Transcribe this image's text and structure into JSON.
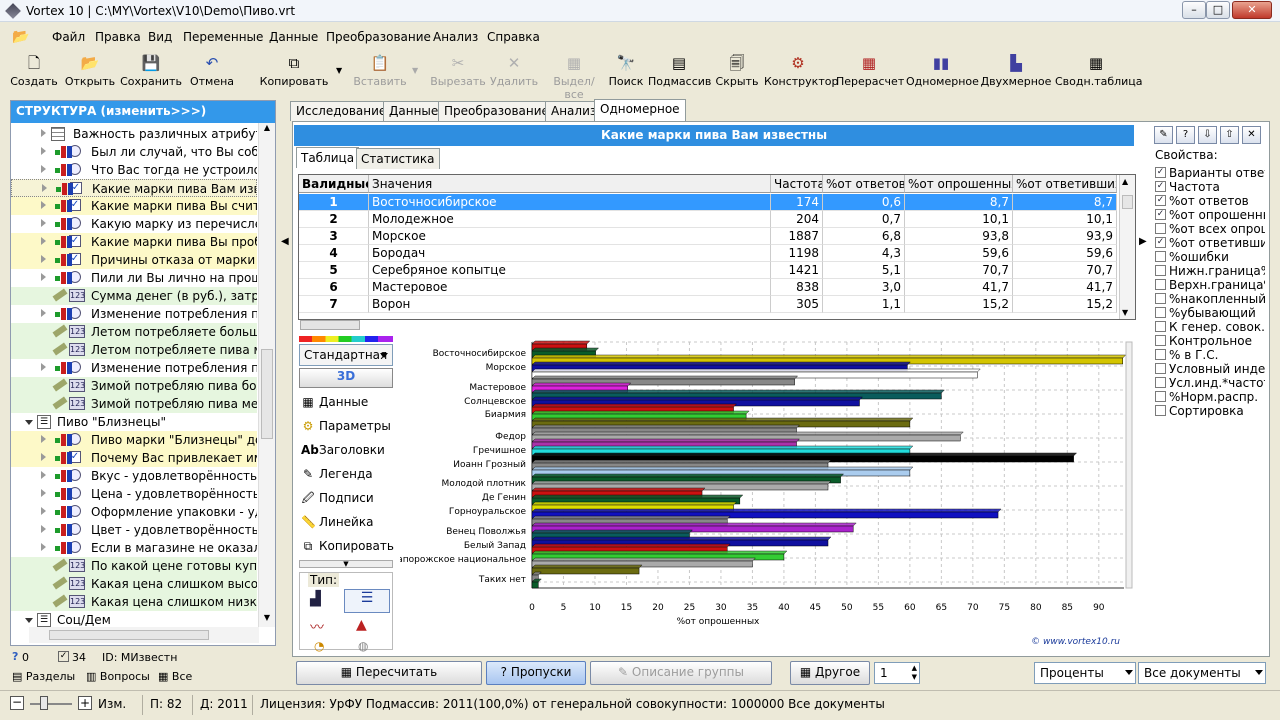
{
  "window": {
    "title": "Vortex 10 | C:\\MY\\Vortex\\V10\\Demo\\Пиво.vrt"
  },
  "menu": [
    "Файл",
    "Правка",
    "Вид",
    "Переменные",
    "Данные",
    "Преобразование",
    "Анализ",
    "Справка"
  ],
  "toolbar": {
    "create": "Создать",
    "open": "Открыть",
    "save": "Сохранить",
    "undo": "Отмена",
    "copy": "Копировать",
    "paste": "Вставить",
    "cut": "Вырезать",
    "delete": "Удалить",
    "select_all": "Выдел/все",
    "search": "Поиск",
    "subarray": "Подмассив",
    "hide": "Скрыть",
    "constructor": "Конструктор",
    "recalc": "Перерасчет",
    "onedim": "Одномерное",
    "twodim": "Двухмерное",
    "pivot": "Сводн.таблица"
  },
  "structure": {
    "header": "СТРУКТУРА (изменить>>>)",
    "items": [
      {
        "label": "Важность различных атрибутов",
        "icon": "grid"
      },
      {
        "label": "Был ли случай, что Вы собир",
        "icon": "q"
      },
      {
        "label": "Что Вас тогда не устроило",
        "icon": "q"
      },
      {
        "label": "Какие марки пива Вам извест",
        "icon": "qc"
      },
      {
        "label": "Какие марки пива Вы считает",
        "icon": "qc"
      },
      {
        "label": "Какую марку из перечисленн",
        "icon": "q"
      },
      {
        "label": "Какие марки пива Вы пробов",
        "icon": "qc"
      },
      {
        "label": "Причины отказа от марки пи",
        "icon": "qc"
      },
      {
        "label": "Пили ли Вы лично на прошло",
        "icon": "q"
      },
      {
        "label": "Сумма денег (в руб.), затрач",
        "icon": "n"
      },
      {
        "label": "Изменение потребления пив",
        "icon": "q"
      },
      {
        "label": "Летом потребляете больше",
        "icon": "n"
      },
      {
        "label": "Летом потребляете пива ме",
        "icon": "n"
      },
      {
        "label": "Изменение потребления пив",
        "icon": "q"
      },
      {
        "label": "Зимой потребляю пива боль",
        "icon": "n"
      },
      {
        "label": "Зимой потребляю пива мень",
        "icon": "n"
      },
      {
        "label": "Пиво \"Близнецы\"",
        "icon": "folder"
      },
      {
        "label": "Пиво марки \"Близнецы\" дорс",
        "icon": "q"
      },
      {
        "label": "Почему Вас привлекает имен",
        "icon": "qc"
      },
      {
        "label": "Вкус - удовлетворённость ма",
        "icon": "q"
      },
      {
        "label": "Цена - удовлетворённость ма",
        "icon": "q"
      },
      {
        "label": "Оформление упаковки - удо",
        "icon": "q"
      },
      {
        "label": "Цвет - удовлетворённость ма",
        "icon": "q"
      },
      {
        "label": "Если в магазине не оказалос",
        "icon": "q"
      },
      {
        "label": "По какой цене готовы купить",
        "icon": "n"
      },
      {
        "label": "Какая цена слишком высокая",
        "icon": "n"
      },
      {
        "label": "Какая цена слишком низкая",
        "icon": "n"
      },
      {
        "label": "Соц/Дем",
        "icon": "folder"
      }
    ],
    "footer": {
      "count_q": "0",
      "count_chk": "34",
      "id_label": "ID: МИзвестн",
      "tab_sections": "Разделы",
      "tab_questions": "Вопросы",
      "tab_all": "Все"
    }
  },
  "tabs": [
    "Исследование",
    "Данные",
    "Преобразование",
    "Анализ",
    "Одномерное"
  ],
  "question_title": "Какие марки пива Вам известны",
  "subtabs": [
    "Таблица",
    "Статистика"
  ],
  "table": {
    "headers": [
      "Валидные",
      "Значения",
      "Частота",
      "%от ответов",
      "%от опрошенных",
      "%от ответивших"
    ],
    "rows": [
      [
        "1",
        "Восточносибирское",
        "174",
        "0,6",
        "8,7",
        "8,7"
      ],
      [
        "2",
        "Молодежное",
        "204",
        "0,7",
        "10,1",
        "10,1"
      ],
      [
        "3",
        "Морское",
        "1887",
        "6,8",
        "93,8",
        "93,9"
      ],
      [
        "4",
        "Бородач",
        "1198",
        "4,3",
        "59,6",
        "59,6"
      ],
      [
        "5",
        "Серебряное копытце",
        "1421",
        "5,1",
        "70,7",
        "70,7"
      ],
      [
        "6",
        "Мастеровое",
        "838",
        "3,0",
        "41,7",
        "41,7"
      ],
      [
        "7",
        "Ворон",
        "305",
        "1,1",
        "15,2",
        "15,2"
      ]
    ]
  },
  "chart_controls": {
    "style": "Стандартная",
    "btn3d": "3D",
    "data": "Данные",
    "params": "Параметры",
    "titles": "Заголовки",
    "legend": "Легенда",
    "captions": "Подписи",
    "ruler": "Линейка",
    "copy": "Копировать",
    "type": "Тип:"
  },
  "chart_data": {
    "type": "bar",
    "orientation": "horizontal",
    "categories": [
      "Восточносибирское",
      "Морское",
      "Мастеровое",
      "Солнцевское",
      "Биармия",
      "Федор",
      "Гречишное",
      "Иоанн Грозный",
      "Молодой плотник",
      "Де Генин",
      "Горноуральское",
      "Венец Поволжья",
      "Белый Запад",
      "Запорожское национальное",
      "Таких нет"
    ],
    "values": [
      10,
      94,
      42,
      65,
      52,
      60,
      65,
      86,
      60,
      48,
      33,
      74,
      52,
      51,
      47
    ],
    "extra_bars": [
      {
        "values": [
          8.7,
          10.1
        ],
        "colors": [
          "#cc1111",
          "#0a5c2a"
        ]
      },
      {
        "values": [
          93.8
        ],
        "colors": [
          "#d4c500"
        ]
      },
      {
        "values": [
          59.6,
          70.7
        ],
        "colors": [
          "#1010a0",
          "#ffffff"
        ]
      },
      {
        "values": [
          41.7,
          15.2
        ],
        "colors": [
          "#888888",
          "#dd22dd"
        ]
      },
      {
        "values": [
          65,
          52
        ],
        "colors": [
          "#0a5c5c",
          "#1010a0"
        ]
      },
      {
        "values": [
          32,
          34
        ],
        "colors": [
          "#cc1111",
          "#33cc33"
        ]
      },
      {
        "values": [
          60,
          42
        ],
        "colors": [
          "#6b6b10",
          "#888888"
        ]
      },
      {
        "values": [
          68,
          42
        ],
        "colors": [
          "#aaaaaa",
          "#aa33aa"
        ]
      },
      {
        "values": [
          60,
          86
        ],
        "colors": [
          "#22dddd",
          "#000000"
        ]
      },
      {
        "values": [
          47,
          60
        ],
        "colors": [
          "#888888",
          "#aaccee"
        ]
      },
      {
        "values": [
          49,
          47
        ],
        "colors": [
          "#0a5c2a",
          "#aaaaaa"
        ]
      },
      {
        "values": [
          27,
          33
        ],
        "colors": [
          "#cc1111",
          "#0a5c2a"
        ]
      },
      {
        "values": [
          32,
          74
        ],
        "colors": [
          "#dddd00",
          "#1010c0"
        ]
      },
      {
        "values": [
          31,
          51
        ],
        "colors": [
          "#888888",
          "#aa22cc"
        ]
      },
      {
        "values": [
          25,
          47
        ],
        "colors": [
          "#0a5c5c",
          "#1010a0"
        ]
      },
      {
        "values": [
          31,
          40
        ],
        "colors": [
          "#cc1111",
          "#33cc33"
        ]
      },
      {
        "values": [
          35,
          17
        ],
        "colors": [
          "#aaaaaa",
          "#6b6b10"
        ]
      },
      {
        "values": [
          1,
          1
        ],
        "colors": [
          "#888888",
          "#0a5c2a"
        ]
      }
    ],
    "xlabel": "%от опрошенных",
    "xlim": [
      0,
      94
    ],
    "xticks": [
      0,
      5,
      10,
      15,
      20,
      25,
      30,
      35,
      40,
      45,
      50,
      55,
      60,
      65,
      70,
      75,
      80,
      85,
      90
    ],
    "grid": true,
    "watermark": "© www.vortex10.ru"
  },
  "properties": {
    "title": "Свойства:",
    "items": [
      {
        "label": "Варианты ответа",
        "checked": true
      },
      {
        "label": "Частота",
        "checked": true
      },
      {
        "label": "%от ответов",
        "checked": true
      },
      {
        "label": "%от опрошенных",
        "checked": true
      },
      {
        "label": "%от всех опрош",
        "checked": false
      },
      {
        "label": "%от ответивших",
        "checked": true
      },
      {
        "label": "%ошибки",
        "checked": false
      },
      {
        "label": "Нижн.граница%",
        "checked": false
      },
      {
        "label": "Верхн.граница%",
        "checked": false
      },
      {
        "label": "%накопленный",
        "checked": false
      },
      {
        "label": "%убывающий",
        "checked": false
      },
      {
        "label": "К генер. совок.",
        "checked": false
      },
      {
        "label": "Контрольное",
        "checked": false
      },
      {
        "label": "% в Г.С.",
        "checked": false
      },
      {
        "label": "Условный индекс",
        "checked": false
      },
      {
        "label": "Усл.инд.*частота",
        "checked": false
      },
      {
        "label": "%Норм.распр.",
        "checked": false
      },
      {
        "label": "Сортировка",
        "checked": false
      }
    ]
  },
  "bottom": {
    "recalc": "Пересчитать",
    "skips": "Пропуски",
    "group_desc": "Описание группы",
    "other": "Другое",
    "spin": "1",
    "mode": "Проценты",
    "docs": "Все документы"
  },
  "status": {
    "mode": "Изм.",
    "p": "П: 82",
    "d": "Д: 2011",
    "license": "Лицензия: УрФУ Подмассив: 2011(100,0%) от генеральной совокупности: 1000000 Все документы"
  }
}
